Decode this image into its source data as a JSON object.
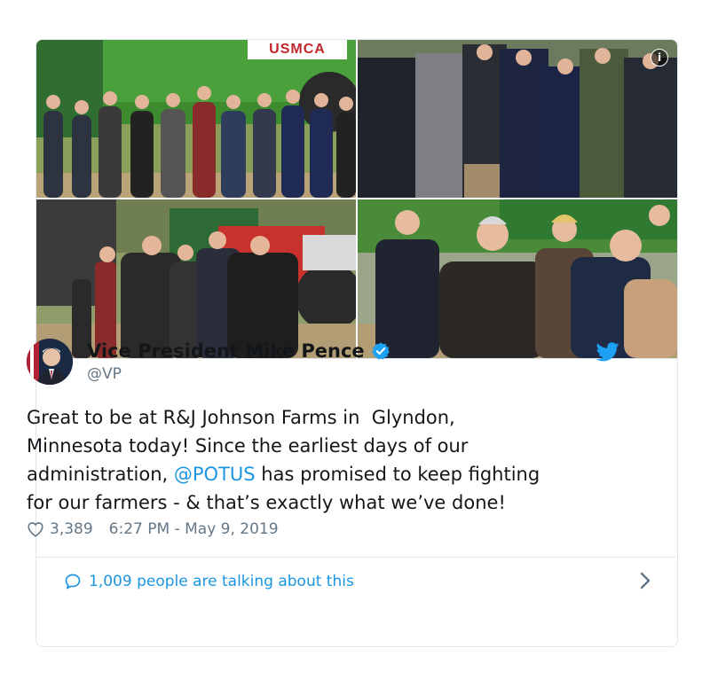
{
  "photos": {
    "banner_text": "USMCA"
  },
  "tweet": {
    "display_name": "Vice President Mike Pence",
    "handle": "@VP",
    "text_before": "Great to be at R&J Johnson Farms in  Glyndon,\nMinnesota today! Since the earliest days of our\nadministration, ",
    "mention": "@POTUS",
    "text_after": " has promised to keep fighting\nfor our farmers - & that’s exactly what we’ve done!",
    "likes": "3,389",
    "timestamp": "6:27 PM - May 9, 2019",
    "talking": "1,009 people are talking about this"
  },
  "icons": {
    "info": "info-icon",
    "verified": "verified-badge-icon",
    "brand": "twitter-bird-icon",
    "like": "heart-icon",
    "reply": "speech-bubble-icon",
    "more": "chevron-right-icon"
  },
  "colors": {
    "accent": "#1b95e0",
    "muted": "#657786",
    "text": "#14171a",
    "border": "#e1e8ed"
  }
}
